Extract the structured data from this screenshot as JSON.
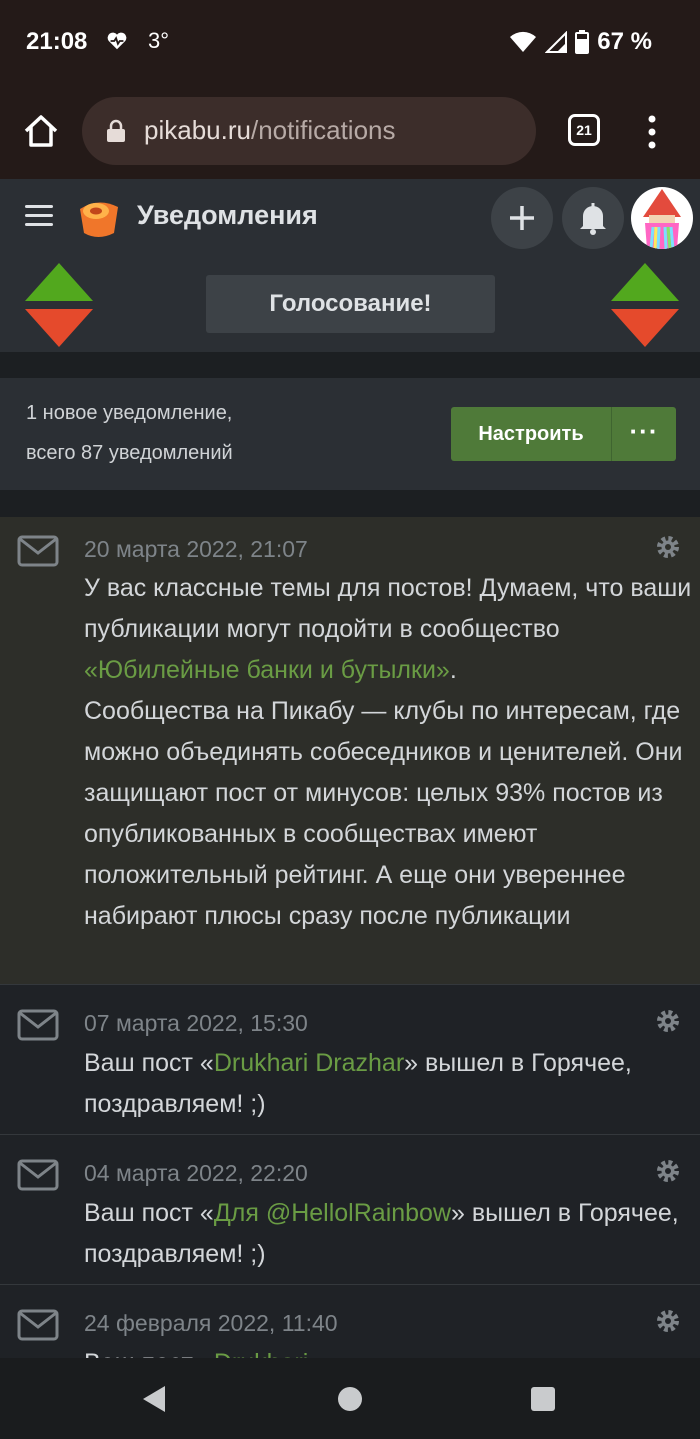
{
  "status": {
    "time": "21:08",
    "temperature": "3°",
    "battery": "67 %"
  },
  "browser": {
    "url_host": "pikabu.ru",
    "url_path": "/notifications",
    "tab_count": "21"
  },
  "header": {
    "title": "Уведомления"
  },
  "vote": {
    "label": "Голосование!"
  },
  "summary": {
    "line1": "1 новое уведомление,",
    "line2": "всего 87 уведомлений",
    "configure_label": "Настроить",
    "more_label": "···"
  },
  "notifications": [
    {
      "date": "20 марта 2022, 21:07",
      "p1_before": "У вас классные темы для постов! Думаем, что ваши публикации могут подойти в сообщество ",
      "p1_link": "«Юбилейные банки и бутылки»",
      "p1_after": ".",
      "p2": "Сообщества на Пикабу — клубы по интересам, где можно объединять собеседников и ценителей. Они защищают пост от минусов: целых 93% постов из опубликованных в сообществах имеют положительный рейтинг. А еще они увереннее набирают плюсы сразу после публикации"
    },
    {
      "date": "07 марта 2022, 15:30",
      "before": "Ваш пост «",
      "link": "Drukhari Drazhar",
      "after": "» вышел в Горячее, поздравляем! ;)"
    },
    {
      "date": "04 марта 2022, 22:20",
      "before": "Ваш пост «",
      "link": "Для @HellolRainbow",
      "after": "» вышел в Горячее, поздравляем! ;)"
    },
    {
      "date": "24 февраля 2022, 11:40",
      "before": "Ваш пост «",
      "link": "Drukhari",
      "after": ""
    }
  ],
  "colors": {
    "accent_green": "#6a9c44",
    "button_green": "#4f7a39",
    "vote_up": "#52a81e",
    "vote_down": "#e54a2c"
  }
}
